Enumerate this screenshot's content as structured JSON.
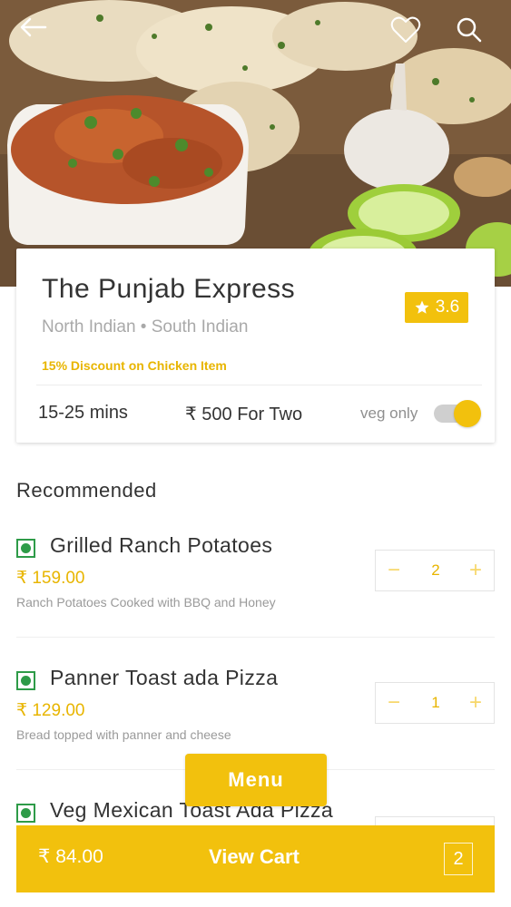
{
  "header": {
    "back_icon": "arrow-left-icon",
    "favorite_icon": "heart-icon",
    "search_icon": "search-icon"
  },
  "restaurant": {
    "name": "The Punjab Express",
    "cuisines": "North Indian • South Indian",
    "offer": "15% Discount on Chicken Item",
    "rating": "3.6",
    "delivery_time": "15-25 mins",
    "cost_for_two": "₹ 500 For Two",
    "veg_only_label": "veg only",
    "veg_only_enabled": true
  },
  "section_title": "Recommended",
  "items": [
    {
      "name": "Grilled Ranch Potatoes",
      "price": "₹ 159.00",
      "description": "Ranch Potatoes Cooked with BBQ and Honey",
      "quantity": "2"
    },
    {
      "name": "Panner Toast ada Pizza",
      "price": "₹ 129.00",
      "description": "Bread topped with panner and cheese",
      "quantity": "1"
    },
    {
      "name": "Veg Mexican Toast Ada Pizza",
      "price": "",
      "description": "",
      "quantity": ""
    }
  ],
  "menu_button": "Menu",
  "cart": {
    "total": "₹ 84.00",
    "label": "View Cart",
    "count": "2"
  },
  "colors": {
    "accent": "#f2c10d",
    "veg_green": "#2e9b48"
  }
}
